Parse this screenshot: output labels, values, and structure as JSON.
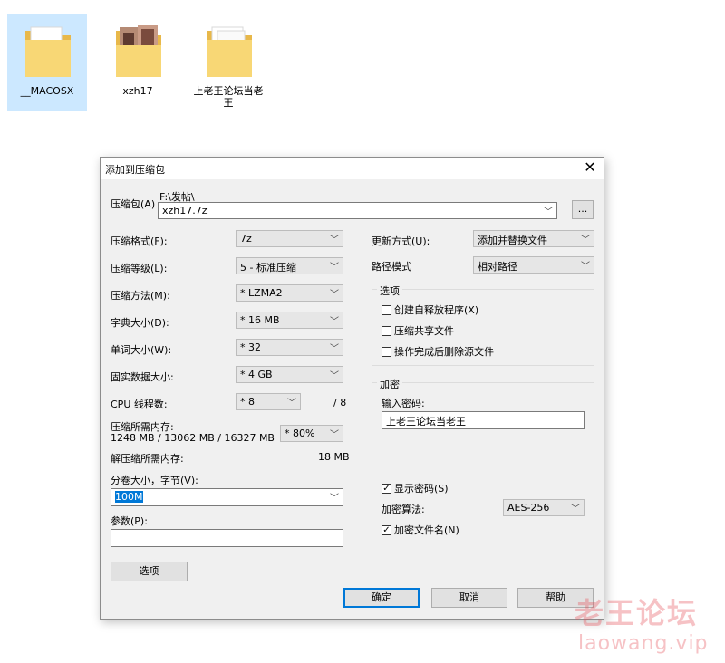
{
  "desktop": {
    "folders": [
      {
        "label": "__MACOSX"
      },
      {
        "label": "xzh17"
      },
      {
        "label": "上老王论坛当老王"
      }
    ]
  },
  "dialog": {
    "title": "添加到压缩包",
    "archive_label": "压缩包(A)",
    "archive_path": "F:\\发帖\\",
    "archive_name": "xzh17.7z",
    "browse_label": "...",
    "format_label": "压缩格式(F):",
    "format_value": "7z",
    "level_label": "压缩等级(L):",
    "level_value": "5 - 标准压缩",
    "method_label": "压缩方法(M):",
    "method_value": "* LZMA2",
    "dict_label": "字典大小(D):",
    "dict_value": "* 16 MB",
    "word_label": "单词大小(W):",
    "word_value": "* 32",
    "solid_label": "固实数据大小:",
    "solid_value": "* 4 GB",
    "cpu_label": "CPU 线程数:",
    "cpu_value": "* 8",
    "cpu_total": "/ 8",
    "mem_label": "压缩所需内存:",
    "mem_detail": "1248 MB / 13062 MB / 16327 MB",
    "mem_percent": "* 80%",
    "decomp_label": "解压缩所需内存:",
    "decomp_value": "18 MB",
    "split_label": "分卷大小，字节(V):",
    "split_value": "100M",
    "params_label": "参数(P):",
    "params_value": "",
    "options_button": "选项",
    "update_label": "更新方式(U):",
    "update_value": "添加并替换文件",
    "pathmode_label": "路径模式",
    "pathmode_value": "相对路径",
    "options_group": "选项",
    "opt_sfx": "创建自释放程序(X)",
    "opt_shared": "压缩共享文件",
    "opt_delete": "操作完成后删除源文件",
    "encrypt_group": "加密",
    "password_label": "输入密码:",
    "password_value": "上老王论坛当老王",
    "show_password": "显示密码(S)",
    "enc_method_label": "加密算法:",
    "enc_method_value": "AES-256",
    "encrypt_names": "加密文件名(N)",
    "ok_button": "确定",
    "cancel_button": "取消",
    "help_button": "帮助"
  },
  "watermark": {
    "line1": "老王论坛",
    "line2": "laowang.vip"
  },
  "colors": {
    "folder_yellow": "#f8d775",
    "selection_blue": "#cce8ff",
    "accent": "#0078d7"
  }
}
